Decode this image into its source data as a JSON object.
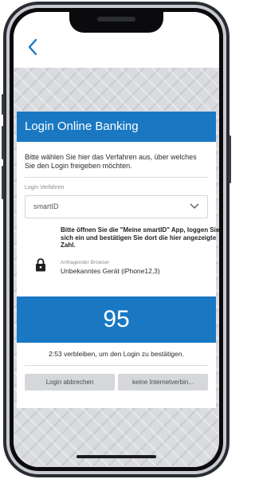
{
  "nav": {
    "back_icon": "chevron-left-icon"
  },
  "card": {
    "title": "Login Online Banking",
    "intro": "Bitte wählen Sie hier das Verfahren aus, über welches Sie den Login freigeben möchten.",
    "method_label": "Login Verfahren",
    "method_value": "smartID",
    "instruction": "Bitte öffnen Sie die \"Meine smartID\" App, loggen Sie sich ein und bestätigen Sie dort die hier angezeigte Zahl.",
    "browser_label": "Anfragender Browser",
    "browser_value": "Unbekanntes Gerät (iPhone12,3)",
    "code": "95",
    "remaining": "2:53 verbleiben, um den Login zu bestätigen.",
    "cancel_label": "Login abbrechen",
    "offline_label": "keine Internetverbin..."
  },
  "colors": {
    "accent": "#1a78c2",
    "button_bg": "#d5d7db"
  }
}
